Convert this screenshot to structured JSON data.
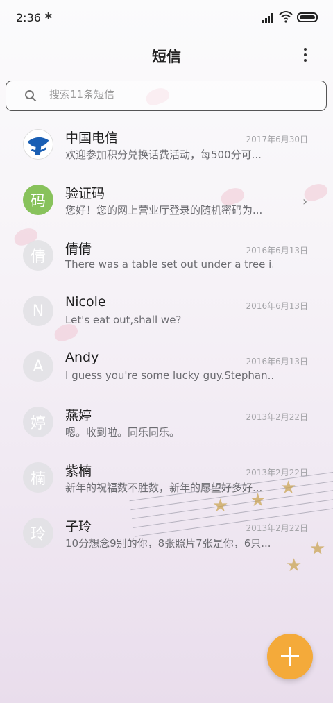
{
  "status_bar": {
    "time": "2:36",
    "bluetooth_icon": "bluetooth-icon",
    "signal_icon": "signal-icon",
    "wifi_icon": "wifi-icon",
    "battery_icon": "battery-icon"
  },
  "header": {
    "title": "短信",
    "more_icon": "more-vertical-icon"
  },
  "search": {
    "placeholder": "搜索11条短信",
    "icon": "search-icon"
  },
  "conversations": [
    {
      "avatar": "",
      "avatar_type": "telecom-logo",
      "name": "中国电信",
      "date": "2017年6月30日",
      "preview": "欢迎参加积分兑换话费活动，每500分可..."
    },
    {
      "avatar": "码",
      "avatar_type": "green",
      "name": "验证码",
      "date": "",
      "preview": "您好！您的网上营业厅登录的随机密码为..."
    },
    {
      "avatar": "倩",
      "avatar_type": "gray",
      "name": "倩倩",
      "date": "2016年6月13日",
      "preview": "There was a table set out under a tree i..."
    },
    {
      "avatar": "N",
      "avatar_type": "gray",
      "name": "Nicole",
      "date": "2016年6月13日",
      "preview": "Let's eat out,shall we?"
    },
    {
      "avatar": "A",
      "avatar_type": "gray",
      "name": "Andy",
      "date": "2016年6月13日",
      "preview": "I guess you're some lucky guy.Stephan..."
    },
    {
      "avatar": "婷",
      "avatar_type": "gray",
      "name": "燕婷",
      "date": "2013年2月22日",
      "preview": "嗯。收到啦。同乐同乐。"
    },
    {
      "avatar": "楠",
      "avatar_type": "gray",
      "name": "紫楠",
      "date": "2013年2月22日",
      "preview": "新年的祝福数不胜数，新年的愿望好多好..."
    },
    {
      "avatar": "玲",
      "avatar_type": "gray",
      "name": "子玲",
      "date": "2013年2月22日",
      "preview": "10分想念9别的你，8张照片7张是你，6只..."
    }
  ],
  "fab": {
    "icon": "plus-icon",
    "color": "#f4aa3a"
  },
  "colors": {
    "accent": "#f4aa3a",
    "verify_avatar": "#88c25c"
  }
}
